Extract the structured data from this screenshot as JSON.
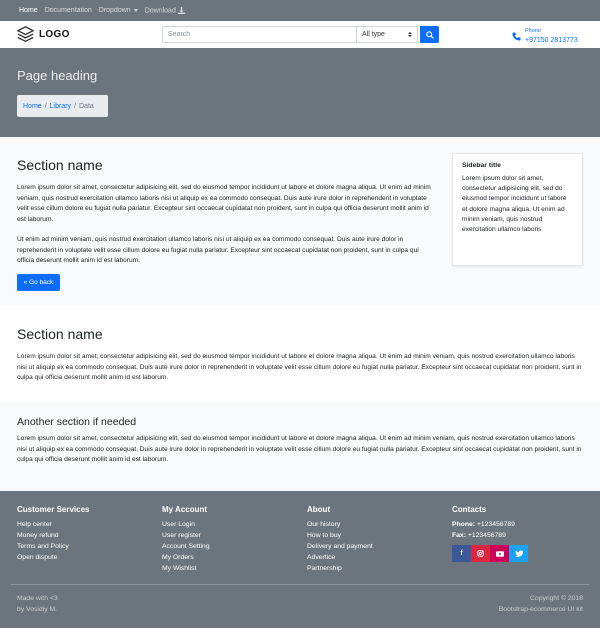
{
  "topnav": {
    "items": [
      "Home",
      "Documentation",
      "Dropdown",
      "Download"
    ]
  },
  "header": {
    "logo": "LOGO",
    "search_placeholder": "Search",
    "select_value": "All type",
    "phone_label": "Phone",
    "phone_number": "+97150 2813773"
  },
  "hero": {
    "heading": "Page heading",
    "breadcrumb": [
      "Home",
      "Library",
      "Data"
    ]
  },
  "section1": {
    "title": "Section name",
    "para1": "Lorem ipsum dolor sit amet, consectetur adipisicing elit, sed do eiusmod tempor incididunt ut labore et dolore magna aliqua. Ut enim ad minim veniam, quis nostrud exercitation ullamco laboris nisi ut aliquip ex ea commodo consequat. Duis aute irure dolor in reprehenderit in voluptate velit esse cillum dolore eu fugiat nulla pariatur. Excepteur sint occaecat cupidatat non proident, sunt in culpa qui officia deserunt mollit anim id est laborum.",
    "para2": "Ut enim ad minim veniam, quis nostrud exercitation ullamco laboris nisi ut aliquip ex ea commodo consequat. Duis aute irure dolor in reprehenderit in voluptate velit esse cillum dolore eu fugiat nulla pariatur. Excepteur sint occaecat cupidatat non proident, sunt in culpa qui officia deserunt mollit anim id est laborum.",
    "back_button": "« Go back"
  },
  "sidebar": {
    "title": "Sidebar title",
    "text": "Lorem ipsum dolor sit amet, consectetur adipisicing elit, sed do eiusmod tempor incididunt ut labore et dolore magna aliqua. Ut enim ad minim veniam, quis nostrud exercitation ullamco laboris"
  },
  "section2": {
    "title": "Section name",
    "para": "Lorem ipsum dolor sit amet, consectetur adipisicing elit, sed do eiusmod tempor incididunt ut labore et dolore magna aliqua. Ut enim ad minim veniam, quis nostrud exercitation ullamco laboris nisi ut aliquip ex ea commodo consequat. Duis aute irure dolor in reprehenderit in voluptate velit esse cillum dolore eu fugiat nulla pariatur. Excepteur sint occaecat cupidatat non proident, sunt in culpa qui officia deserunt mollit anim id est laborum."
  },
  "section3": {
    "title": "Another section if needed",
    "para": "Lorem ipsum dolor sit amet, consectetur adipisicing elit, sed do eiusmod tempor incididunt ut labore et dolore magna aliqua. Ut enim ad minim veniam, quis nostrud exercitation ullamco laboris nisi ut aliquip ex ea commodo consequat. Duis aute irure dolor in reprehenderit in voluptate velit esse cillum dolore eu fugiat nulla pariatur. Excepteur sint occaecat cupidatat non proident, sunt in culpa qui officia deserunt mollit anim id est laborum."
  },
  "footer": {
    "customer": {
      "title": "Customer Services",
      "items": [
        "Help center",
        "Money refund",
        "Terms and Policy",
        "Open dispute"
      ]
    },
    "account": {
      "title": "My Account",
      "items": [
        "User Login",
        "User register",
        "Account Setting",
        "My Orders",
        "My Wishlist"
      ]
    },
    "about": {
      "title": "About",
      "items": [
        "Our history",
        "How to buy",
        "Delivery and payment",
        "Advertice",
        "Partnership"
      ]
    },
    "contacts": {
      "title": "Contacts",
      "phone_label": "Phone:",
      "phone_value": "+123456789",
      "fax_label": "Fax:",
      "fax_value": "+123456789",
      "social": [
        "f",
        "ig",
        "yt",
        "tw"
      ]
    },
    "made_with": "Made with <3",
    "by": "by Vosidiy M.",
    "copyright": "Copyright © 2018",
    "kit": "Bootstrap-ecommerce UI kit"
  },
  "colors": {
    "primary": "#0d6efd",
    "gray": "#6c757d",
    "light": "#f8f9fa"
  }
}
